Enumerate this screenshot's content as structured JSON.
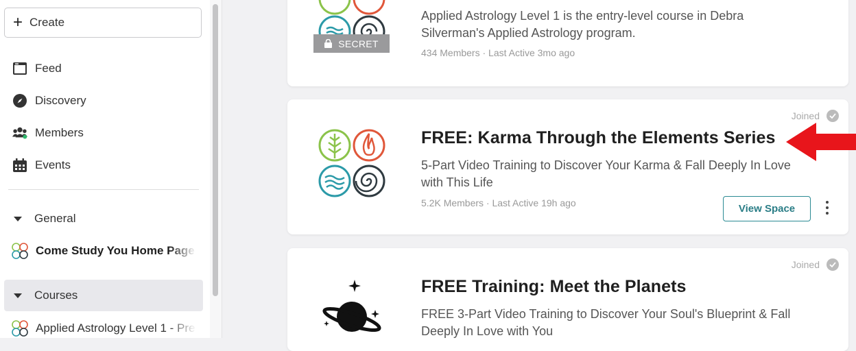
{
  "sidebar": {
    "create_label": "Create",
    "nav": [
      {
        "label": "Feed",
        "icon": "feed-icon"
      },
      {
        "label": "Discovery",
        "icon": "compass-icon"
      },
      {
        "label": "Members",
        "icon": "members-icon"
      },
      {
        "label": "Events",
        "icon": "calendar-icon"
      }
    ],
    "sections": {
      "general": "General",
      "courses": "Courses"
    },
    "spaces": [
      {
        "label": "Come Study You Home Page"
      },
      {
        "label": "Applied Astrology Level 1 - Pre"
      }
    ]
  },
  "cards": [
    {
      "description": "Applied Astrology Level 1 is the entry-level course in Debra Silverman's Applied Astrology program.",
      "badge": "SECRET",
      "meta": "434 Members · Last Active 3mo ago"
    },
    {
      "title": "FREE: Karma Through the Elements Series",
      "description": "5-Part Video Training to Discover Your Karma & Fall Deeply In Love with This Life",
      "meta": "5.2K Members · Last Active 19h ago",
      "joined_label": "Joined",
      "button_label": "View Space"
    },
    {
      "title": "FREE Training: Meet the Planets",
      "description": "FREE 3-Part Video Training to Discover Your Soul's Blueprint & Fall Deeply In Love with You",
      "joined_label": "Joined"
    }
  ],
  "colors": {
    "accent": "#2a8a93",
    "arrow": "#e8151b",
    "element_green": "#8bc34a",
    "element_red": "#e0573a",
    "element_teal": "#2b9aa8",
    "element_dark": "#2f3a40"
  }
}
